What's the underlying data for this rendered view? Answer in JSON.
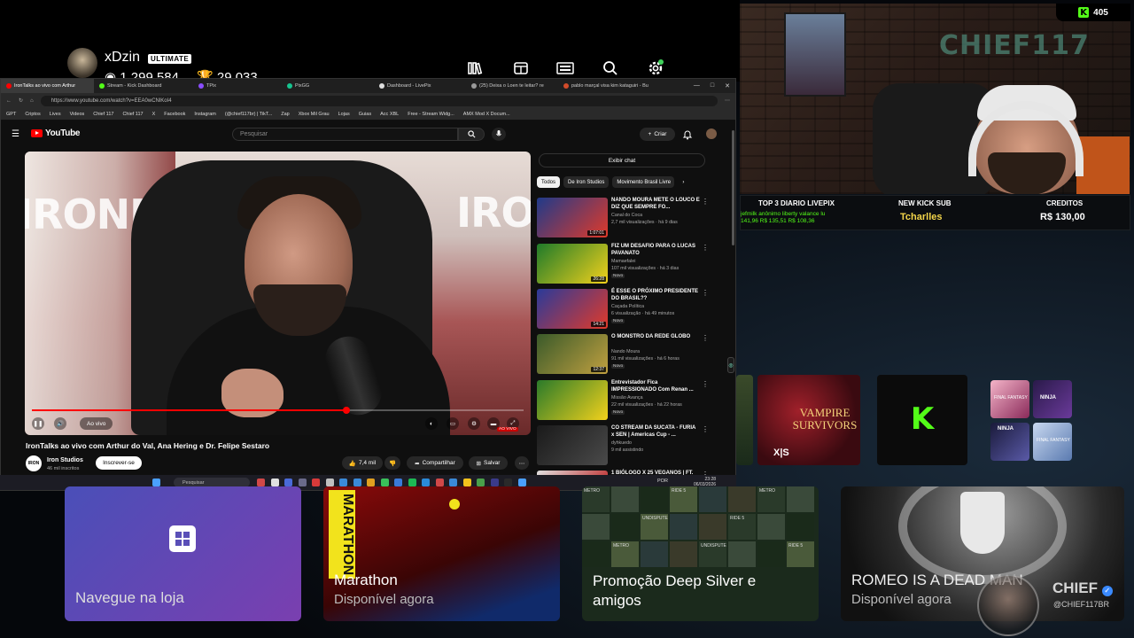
{
  "xbox": {
    "gamertag": "xDzin",
    "badge": "ULTIMATE",
    "gamerscore": "1.299.584",
    "achievements": "29.033",
    "icons": [
      "library-icon",
      "store-icon",
      "game-pass-icon",
      "search-icon",
      "settings-icon"
    ]
  },
  "browser": {
    "tabs": [
      {
        "label": "IronTalks ao vivo com Arthur",
        "color": "#ff0000"
      },
      {
        "label": "Stream - Kick Dashboard",
        "color": "#53fc18"
      },
      {
        "label": "TPix",
        "color": "#8a4dff"
      },
      {
        "label": "PixGG",
        "color": "#16c48f"
      },
      {
        "label": "Dashboard - LivePix",
        "color": "#dddddd"
      },
      {
        "label": "(25) Deixa o Loen te leitar? re",
        "color": "#999999"
      },
      {
        "label": "pablo marçal visa kim kataguiri - Bu",
        "color": "#d24b2a"
      }
    ],
    "url": "https://www.youtube.com/watch?v=EEA0wCNlKoI4",
    "bookmarks": [
      "GPT",
      "Criptos",
      "Lives",
      "Videos",
      "Chief 117",
      "Chief 117",
      "X",
      "Facebook",
      "Instagram",
      "(@chief117br) | TikT...",
      "Zap",
      "Xbox Mil Grau",
      "Lojas",
      "Guias",
      "Acc XBL",
      "Free - Stream Widg...",
      "AMX Mod X Docum..."
    ]
  },
  "youtube": {
    "logo": "YouTube",
    "search_placeholder": "Pesquisar",
    "create_label": "Criar",
    "player": {
      "brand_left": "IRONBERG",
      "brand_right": "IRON",
      "live_label": "Ao vivo",
      "progress_fraction": 0.64
    },
    "video_title": "IronTalks ao vivo com Arthur do Val, Ana Hering e Dr. Felipe Sestaro",
    "channel": {
      "name": "Iron Studios",
      "subscribers": "46 mil inscritos",
      "avatar_text": "IRON"
    },
    "subscribe_label": "Inscrever-se",
    "likes": "7,4 mil",
    "share_label": "Compartilhar",
    "save_label": "Salvar",
    "show_chat": "Exibir chat",
    "chips": [
      "Todos",
      "De Iron Studios",
      "Movimento Brasil Livre"
    ],
    "recommendations": [
      {
        "title": "NANDO MOURA METE O LOUCO E DIZ QUE SEMPRE FO...",
        "channel": "Canal do Coca",
        "meta": "2,7 mil visualizações · há 9 dias",
        "duration": "1:07:01",
        "badge": "",
        "thumb": [
          "#1f3a8a",
          "#e03a2a"
        ]
      },
      {
        "title": "FIZ UM DESAFIO PARA O LUCAS PAVANATO",
        "channel": "Mamaefalei",
        "meta": "107 mil visualizações · há 3 dias",
        "duration": "26:28",
        "badge": "Novo",
        "thumb": [
          "#1e7a2a",
          "#f2d11c"
        ]
      },
      {
        "title": "É ESSE O PRÓXIMO PRESIDENTE DO BRASIL??",
        "channel": "Caçada Política",
        "meta": "6 visualização · há 49 minutos",
        "duration": "14:21",
        "badge": "Novo",
        "thumb": [
          "#2a3a9a",
          "#e03a2a"
        ]
      },
      {
        "title": "O MONSTRO DA REDE GLOBO",
        "channel": "Nando Moura",
        "meta": "91 mil visualizações · há 6 horas",
        "duration": "12:37",
        "badge": "Novo",
        "thumb": [
          "#3a5a2a",
          "#c0a040"
        ]
      },
      {
        "title": "Entrevistador Fica IMPRESSIONADO Com Renan ...",
        "channel": "Missão Avança",
        "meta": "22 mil visualizações · há 22 horas",
        "duration": "",
        "badge": "Novo",
        "thumb": [
          "#2a7a2a",
          "#f2d11c"
        ]
      },
      {
        "title": "CO STREAM DA SUCATA - FURIA x SEN | Americas Cup - ...",
        "channel": "dyhkuedo",
        "meta": "9 mil assistindo",
        "duration": "",
        "badge": "AO VIVO",
        "thumb": [
          "#1a1a1a",
          "#4a4a4a"
        ]
      },
      {
        "title": "1 BIÓLOGO X 25 VEGANOS | FT.",
        "channel": "",
        "meta": "",
        "duration": "",
        "badge": "",
        "thumb": [
          "#e0e0e0",
          "#c03030"
        ]
      }
    ]
  },
  "taskbar": {
    "search": "Pesquisar",
    "lang": "POR",
    "time": "23:28",
    "date": "06/03/2026"
  },
  "stream": {
    "kick_count": "405",
    "ticker": {
      "top_label": "TOP 3 DIARIO LIVEPIX",
      "top_names": "jefmilk   anônimo   liberty valance   lu",
      "top_amounts": "141,96   R$ 135,51   R$ 108,36",
      "sub_label": "NEW KICK SUB",
      "sub_name": "Tcharlles",
      "credit_label": "CREDITOS",
      "credit_value": "R$ 130,00"
    },
    "cam_logo": "CHIEF117"
  },
  "tiles": {
    "vampire": "VAMPIRE SURVIVORS",
    "xs": "X|S",
    "ff_labels": [
      "FINAL FANTASY",
      "NINJA",
      "NINJA",
      "FINAL FANTASY"
    ],
    "store": {
      "title": "Navegue na loja"
    },
    "marathon": {
      "title": "Marathon",
      "subtitle": "Disponível agora",
      "vertical": "MARATHON"
    },
    "deep_silver": {
      "title": "Promoção Deep Silver e amigos"
    },
    "romeo": {
      "title": "ROMEO IS A DEAD MAN",
      "subtitle": "Disponível agora"
    },
    "ds_labels": [
      "METRO",
      "RIDE 5",
      "METRO",
      "UNDISPUTED",
      "RIDE 5",
      "METRO",
      "UNDISPUTED",
      "RIDE 5"
    ]
  },
  "watermark": {
    "name": "CHIEF",
    "handle": "@CHIEF117BR"
  }
}
